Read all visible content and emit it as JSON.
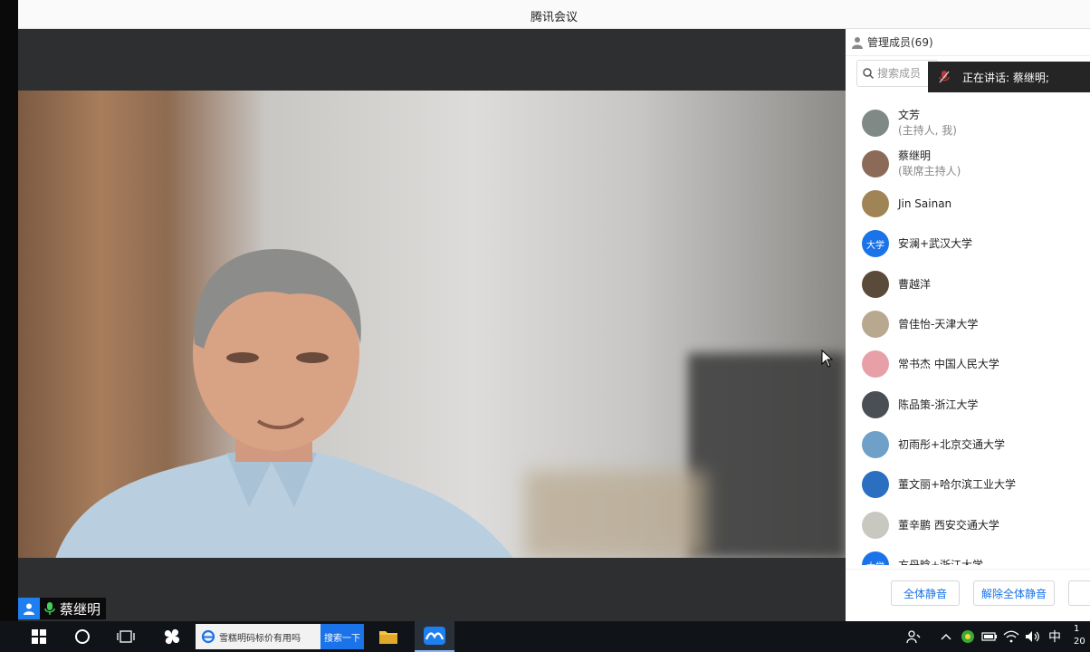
{
  "window": {
    "title": "腾讯会议"
  },
  "video": {
    "speaker_name": "蔡继明"
  },
  "panel": {
    "header_label": "管理成员(69)",
    "search_placeholder": "搜索成员",
    "speaking_text": "正在讲话: 蔡继明;",
    "members": [
      {
        "name": "文芳",
        "role": "(主持人, 我)",
        "avatar": "photo",
        "color": "#7f8a86"
      },
      {
        "name": "蔡继明",
        "role": "(联席主持人)",
        "avatar": "photo",
        "color": "#8b6b58"
      },
      {
        "name": "Jin Sainan",
        "role": "",
        "avatar": "photo",
        "color": "#a08456"
      },
      {
        "name": "安澜+武汉大学",
        "role": "",
        "avatar": "text",
        "avatar_text": "大学",
        "color": "#1a73e8"
      },
      {
        "name": "曹越洋",
        "role": "",
        "avatar": "photo",
        "color": "#5a4a3a"
      },
      {
        "name": "曾佳怡-天津大学",
        "role": "",
        "avatar": "photo",
        "color": "#b8a890"
      },
      {
        "name": "常书杰 中国人民大学",
        "role": "",
        "avatar": "photo",
        "color": "#e8a0a8"
      },
      {
        "name": "陈品策-浙江大学",
        "role": "",
        "avatar": "photo",
        "color": "#4a4f55"
      },
      {
        "name": "初雨彤+北京交通大学",
        "role": "",
        "avatar": "photo",
        "color": "#6fa0c8"
      },
      {
        "name": "董文丽+哈尔滨工业大学",
        "role": "",
        "avatar": "photo",
        "color": "#2a6fc0"
      },
      {
        "name": "董辛鹏 西安交通大学",
        "role": "",
        "avatar": "photo",
        "color": "#c8c8c0"
      },
      {
        "name": "方丹晗+浙江大学",
        "role": "",
        "avatar": "text",
        "avatar_text": "大学",
        "color": "#1a73e8"
      }
    ],
    "buttons": {
      "mute_all": "全体静音",
      "unmute_all": "解除全体静音"
    }
  },
  "taskbar": {
    "search_text": "雪糕明码标价有用吗",
    "search_button": "搜索一下",
    "ime": "中",
    "clock_line1": "1",
    "clock_line2": "20"
  }
}
